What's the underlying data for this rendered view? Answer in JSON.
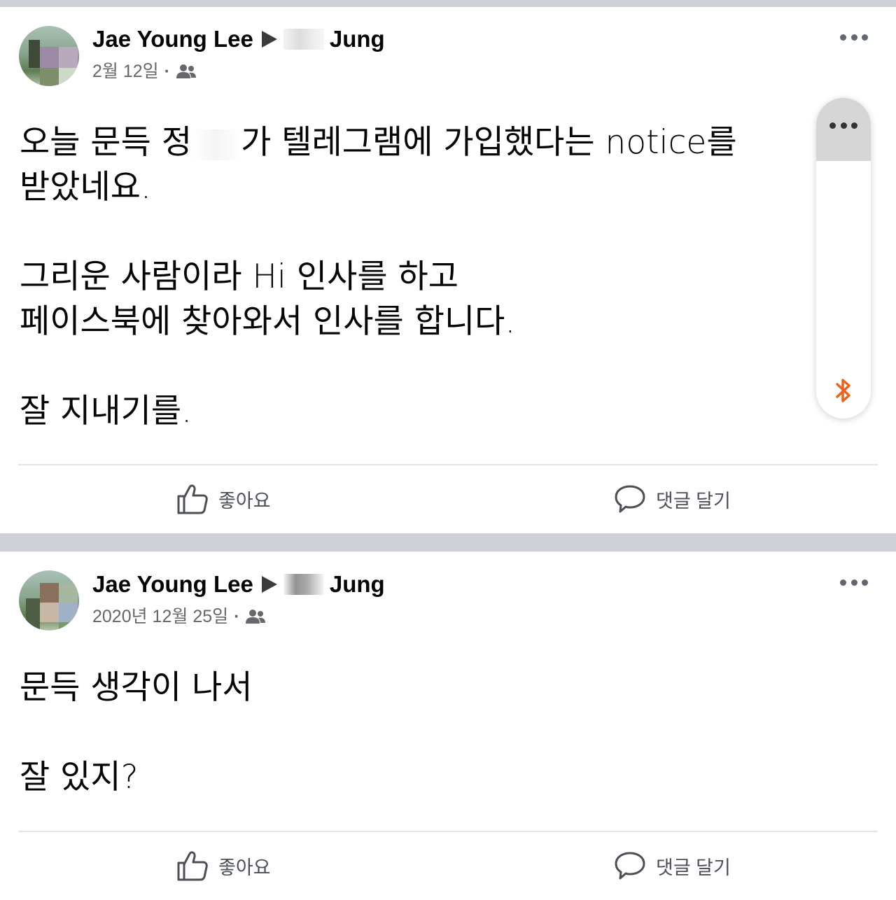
{
  "posts": [
    {
      "author": "Jae Young Lee",
      "recipient": "Jung",
      "date": "2월 12일",
      "audience_icon": "friends-icon",
      "lines": [
        {
          "parts": [
            "오늘 문득 정",
            "가 텔레그램에 가입했다는 notice를"
          ]
        },
        {
          "text": "받았네요."
        },
        {
          "text": ""
        },
        {
          "text": "그리운 사람이라 Hi 인사를 하고"
        },
        {
          "text": "페이스북에 찾아와서 인사를 합니다."
        },
        {
          "text": ""
        },
        {
          "text": "잘 지내기를."
        }
      ],
      "like_label": "좋아요",
      "comment_label": "댓글 달기"
    },
    {
      "author": "Jae Young Lee",
      "recipient": "Jung",
      "date": "2020년 12월 25일",
      "audience_icon": "friends-icon",
      "lines": [
        {
          "text": "문득 생각이 나서"
        },
        {
          "text": ""
        },
        {
          "text": "잘 있지?"
        }
      ],
      "like_label": "좋아요",
      "comment_label": "댓글 달기"
    }
  ],
  "overlay": {
    "menu_icon": "more-dots-icon",
    "bluetooth_icon": "bluetooth-icon",
    "bluetooth_color": "#e8641f"
  },
  "colors": {
    "separator": "#cdd1d7",
    "meta_text": "#65676b"
  }
}
